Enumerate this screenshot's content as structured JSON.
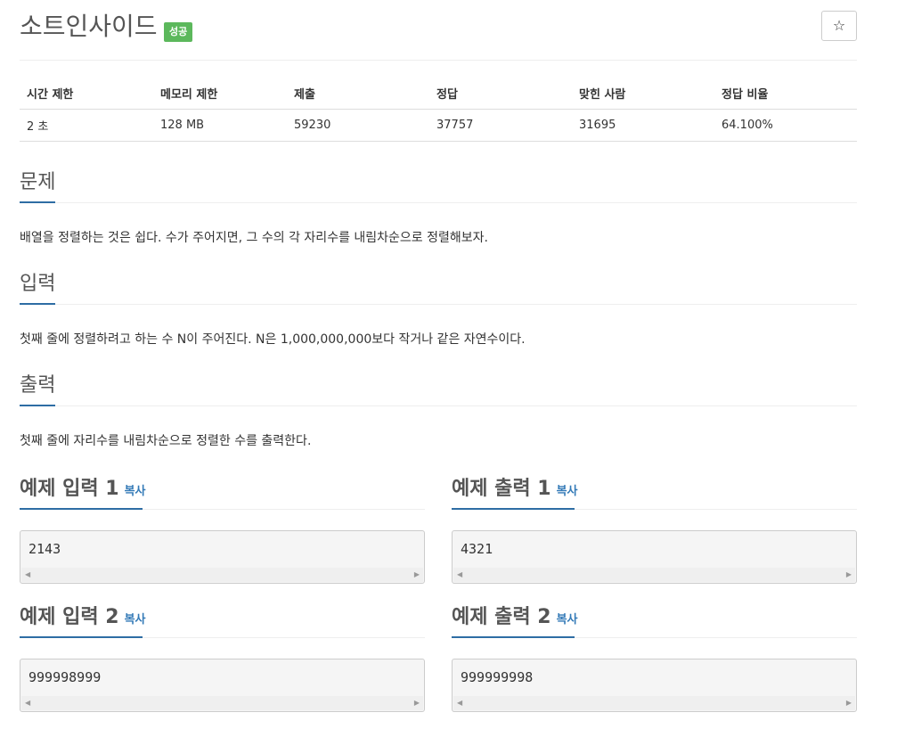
{
  "header": {
    "title": "소트인사이드",
    "badge": "성공",
    "star_icon": "☆"
  },
  "stats": {
    "headers": [
      "시간 제한",
      "메모리 제한",
      "제출",
      "정답",
      "맞힌 사람",
      "정답 비율"
    ],
    "values": [
      "2 초",
      "128 MB",
      "59230",
      "37757",
      "31695",
      "64.100%"
    ]
  },
  "sections": {
    "problem": {
      "heading": "문제",
      "text": "배열을 정렬하는 것은 쉽다. 수가 주어지면, 그 수의 각 자리수를 내림차순으로 정렬해보자."
    },
    "input": {
      "heading": "입력",
      "text": "첫째 줄에 정렬하려고 하는 수 N이 주어진다. N은 1,000,000,000보다 작거나 같은 자연수이다."
    },
    "output": {
      "heading": "출력",
      "text": "첫째 줄에 자리수를 내림차순으로 정렬한 수를 출력한다."
    }
  },
  "samples": {
    "copy_label": "복사",
    "input1": {
      "heading": "예제 입력 1",
      "value": "2143"
    },
    "output1": {
      "heading": "예제 출력 1",
      "value": "4321"
    },
    "input2": {
      "heading": "예제 입력 2",
      "value": "999998999"
    },
    "output2": {
      "heading": "예제 출력 2",
      "value": "999999998"
    },
    "scroll_left": "◀",
    "scroll_right": "▶"
  },
  "colors": {
    "badge": "#5cb85c",
    "accent": "#2e6da4",
    "link": "#337ab7"
  }
}
